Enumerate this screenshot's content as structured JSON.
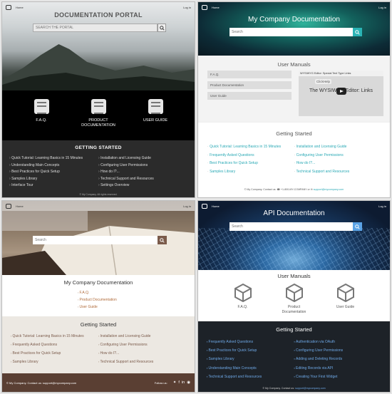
{
  "common": {
    "home": "Home",
    "login": "Log in"
  },
  "p1": {
    "title": "DOCUMENTATION PORTAL",
    "search_placeholder": "SEARCH THE PORTAL",
    "icons": [
      "F.A.Q.",
      "PRODUCT DOCUMENTATION",
      "USER GUIDE"
    ],
    "gs_title": "GETTING STARTED",
    "col1": [
      "Quick Tutorial: Learning Basics in 15 Minutes",
      "Understanding Main Concepts",
      "Best Practices for Quick Setup",
      "Samples Library",
      "Interface Tour"
    ],
    "col2": [
      "Installation and Licensing Guide",
      "Configuring User Permissions",
      "How do I?...",
      "Technical Support and Resources",
      "Settings Overview"
    ],
    "copyright": "© My Company. All rights reserved."
  },
  "p2": {
    "title": "My Company Documentation",
    "search_placeholder": "Search",
    "manuals_title": "User Manuals",
    "manuals": [
      "F.A.Q.",
      "Product Documentation",
      "User Guide"
    ],
    "video_title": "WYSIWYG Editor: Special Text Type Links",
    "video_channel": "ClickHelp",
    "video_main": "The WYSIWYG Editor: Links",
    "gs_title": "Getting Started",
    "col1": [
      "Quick Tutorial: Learning Basics in 15 Minutes",
      "Frequently Asked Questions",
      "Best Practices for Quick Setup",
      "Samples Library"
    ],
    "col2": [
      "Installation and Licensing Guide",
      "Configuring User Permissions",
      "How do I?...",
      "Technical Support and Resources"
    ],
    "foot_text": "© My Company. Contact us: ☎ +1-800-MY-COMPANY or ✉ ",
    "foot_email": "support@mycompany.com"
  },
  "p3": {
    "search_placeholder": "Search",
    "doc_title": "My Company Documentation",
    "links": [
      "F.A.Q.",
      "Product Documentation",
      "User Guide"
    ],
    "gs_title": "Getting Started",
    "col1": [
      "Quick Tutorial: Learning Basics in 15 Minutes",
      "Frequently Asked Questions",
      "Best Practices for Quick Setup",
      "Samples Library"
    ],
    "col2": [
      "Installation and Licensing Guide",
      "Configuring User Permissions",
      "How do I?...",
      "Technical Support and Resources"
    ],
    "foot_text": "© My Company. Contact us: support@mycompany.com",
    "follow": "Follow us:"
  },
  "p4": {
    "title": "API Documentation",
    "search_placeholder": "Search",
    "manuals_title": "User Manuals",
    "icons": [
      "F.A.Q.",
      "Product Documentation",
      "User Guide"
    ],
    "gs_title": "Getting Started",
    "col1": [
      "Frequently Asked Questions",
      "Best Practices for Quick Setup",
      "Samples Library",
      "Understanding Main Concepts",
      "Technical Support and Resources"
    ],
    "col2": [
      "Authentication via OAuth",
      "Configuring User Permissions",
      "Adding and Deleting Records",
      "Editing Records via API",
      "Creating Your First Widget"
    ],
    "foot_text": "© My Company. Contact us: ",
    "foot_email": "support@mycompany.com"
  }
}
